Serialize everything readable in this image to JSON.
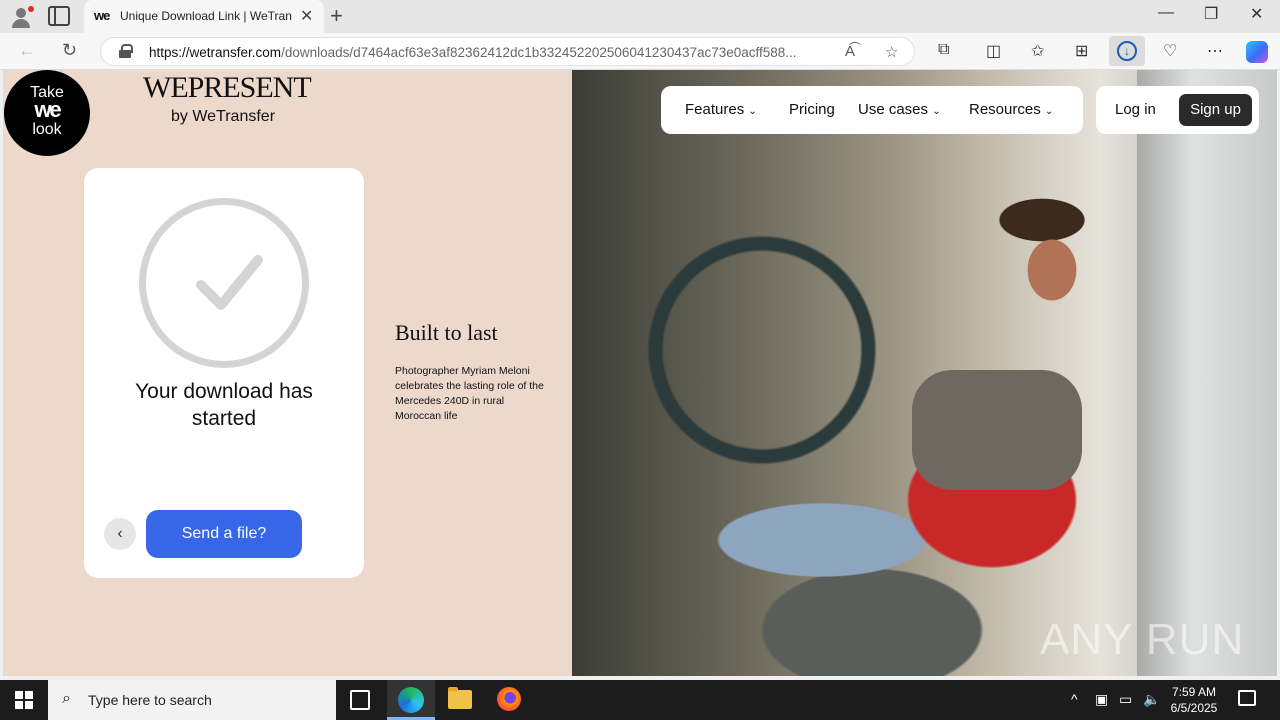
{
  "browser": {
    "tab_title": "Unique Download Link | WeTransfer",
    "tab_favicon": "we",
    "url_host": "https://wetransfer.com",
    "url_path": "/downloads/d7464acf63e3af82362412dc1b332452202506041230437ac73e0acff588...",
    "icons": [
      "profile-icon",
      "tab-actions-icon",
      "close-tab-icon",
      "new-tab-icon",
      "back-icon",
      "refresh-icon",
      "lock-icon",
      "read-aloud-icon",
      "favorite-icon",
      "extensions-icon",
      "split-screen-icon",
      "favorites-icon",
      "collections-icon",
      "downloads-icon",
      "browser-essentials-icon",
      "more-icon",
      "copilot-icon",
      "minimize-icon",
      "restore-icon",
      "close-window-icon"
    ]
  },
  "page": {
    "badge": {
      "line1": "Take",
      "line2": "we",
      "line3": "look"
    },
    "brand": {
      "name": "WEPRESENT",
      "sub": "by WeTransfer"
    },
    "card": {
      "title": "Your download has started",
      "send_label": "Send a file?",
      "back_glyph": "‹"
    },
    "story": {
      "title": "Built to last",
      "text": "Photographer Myriam Meloni celebrates the lasting role of the Mercedes 240D in rural Moroccan life"
    },
    "nav": {
      "items": [
        {
          "label": "Features",
          "dropdown": true
        },
        {
          "label": "Pricing",
          "dropdown": false
        },
        {
          "label": "Use cases",
          "dropdown": true
        },
        {
          "label": "Resources",
          "dropdown": true
        }
      ],
      "login": "Log in",
      "signup": "Sign up"
    },
    "watermark": "ANY RUN",
    "colors": {
      "accent": "#3767e8",
      "page_bg": "#ecd9cb",
      "signup_bg": "#2a2a2a"
    }
  },
  "taskbar": {
    "search_placeholder": "Type here to search",
    "time": "7:59 AM",
    "date": "6/5/2025"
  }
}
